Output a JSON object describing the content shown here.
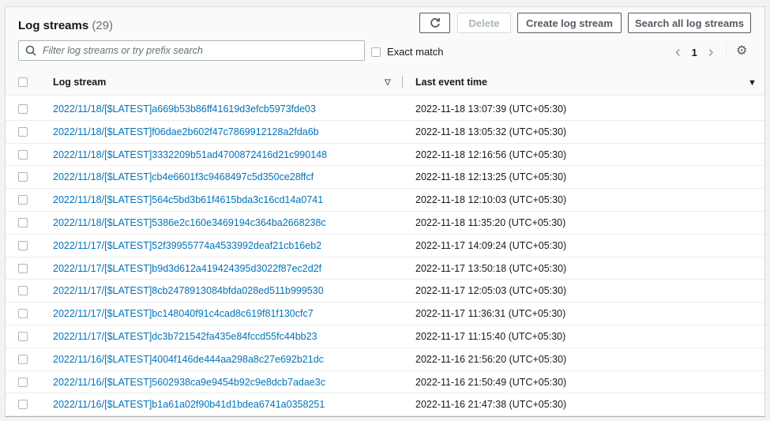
{
  "header": {
    "title": "Log streams",
    "count": "(29)",
    "refresh_icon": "refresh-icon",
    "delete_label": "Delete",
    "create_label": "Create log stream",
    "search_all_label": "Search all log streams"
  },
  "filter": {
    "placeholder": "Filter log streams or try prefix search",
    "value": "",
    "exact_match_label": "Exact match"
  },
  "pagination": {
    "current_page": "1",
    "prev": "‹",
    "next": "›"
  },
  "table": {
    "columns": [
      "Log stream",
      "Last event time"
    ],
    "rows": [
      {
        "stream": "2022/11/18/[$LATEST]a669b53b86ff41619d3efcb5973fde03",
        "time": "2022-11-18 13:07:39 (UTC+05:30)"
      },
      {
        "stream": "2022/11/18/[$LATEST]f06dae2b602f47c7869912128a2fda6b",
        "time": "2022-11-18 13:05:32 (UTC+05:30)"
      },
      {
        "stream": "2022/11/18/[$LATEST]3332209b51ad4700872416d21c990148",
        "time": "2022-11-18 12:16:56 (UTC+05:30)"
      },
      {
        "stream": "2022/11/18/[$LATEST]cb4e6601f3c9468497c5d350ce28ffcf",
        "time": "2022-11-18 12:13:25 (UTC+05:30)"
      },
      {
        "stream": "2022/11/18/[$LATEST]564c5bd3b61f4615bda3c16cd14a0741",
        "time": "2022-11-18 12:10:03 (UTC+05:30)"
      },
      {
        "stream": "2022/11/18/[$LATEST]5386e2c160e3469194c364ba2668238c",
        "time": "2022-11-18 11:35:20 (UTC+05:30)"
      },
      {
        "stream": "2022/11/17/[$LATEST]52f39955774a4533992deaf21cb16eb2",
        "time": "2022-11-17 14:09:24 (UTC+05:30)"
      },
      {
        "stream": "2022/11/17/[$LATEST]b9d3d612a419424395d3022f87ec2d2f",
        "time": "2022-11-17 13:50:18 (UTC+05:30)"
      },
      {
        "stream": "2022/11/17/[$LATEST]8cb2478913084bfda028ed511b999530",
        "time": "2022-11-17 12:05:03 (UTC+05:30)"
      },
      {
        "stream": "2022/11/17/[$LATEST]bc148040f91c4cad8c619f81f130cfc7",
        "time": "2022-11-17 11:36:31 (UTC+05:30)"
      },
      {
        "stream": "2022/11/17/[$LATEST]dc3b721542fa435e84fccd55fc44bb23",
        "time": "2022-11-17 11:15:40 (UTC+05:30)"
      },
      {
        "stream": "2022/11/16/[$LATEST]4004f146de444aa298a8c27e692b21dc",
        "time": "2022-11-16 21:56:20 (UTC+05:30)"
      },
      {
        "stream": "2022/11/16/[$LATEST]5602938ca9e9454b92c9e8dcb7adae3c",
        "time": "2022-11-16 21:50:49 (UTC+05:30)"
      },
      {
        "stream": "2022/11/16/[$LATEST]b1a61a02f90b41d1bdea6741a0358251",
        "time": "2022-11-16 21:47:38 (UTC+05:30)"
      }
    ]
  }
}
